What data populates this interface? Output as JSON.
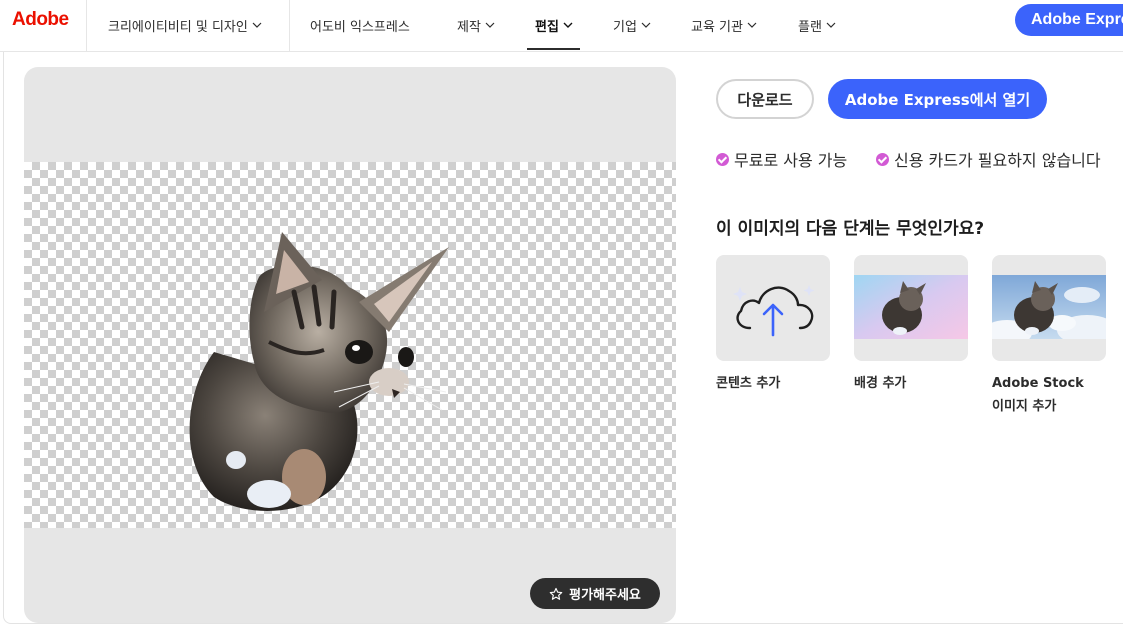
{
  "nav": {
    "logo": "Adobe",
    "items": [
      {
        "label": "크리에이티비티 및 디자인",
        "chevron": true
      },
      {
        "label": "어도비 익스프레스",
        "chevron": false
      },
      {
        "label": "제작",
        "chevron": true
      },
      {
        "label": "편집",
        "chevron": true,
        "active": true
      },
      {
        "label": "기업",
        "chevron": true
      },
      {
        "label": "교육 기관",
        "chevron": true
      },
      {
        "label": "플랜",
        "chevron": true
      }
    ],
    "cta": "Adobe Express"
  },
  "preview": {
    "rate_label": "평가해주세요",
    "rate_icon": "star-icon"
  },
  "actions": {
    "download": "다운로드",
    "open": "Adobe Express에서 열기"
  },
  "perks": [
    "무료로 사용 가능",
    "신용 카드가 필요하지 않습니다"
  ],
  "next_steps": {
    "title": "이 이미지의 다음 단계는 무엇인가요?",
    "items": [
      {
        "line1": "콘텐츠 추가",
        "line2": "",
        "icon": "cloud-upload-icon"
      },
      {
        "line1": "배경 추가",
        "line2": "",
        "icon": "kitten-gradient-thumbnail"
      },
      {
        "line1": "Adobe Stock",
        "line2": "이미지 추가",
        "icon": "kitten-sky-thumbnail"
      }
    ]
  },
  "colors": {
    "accent": "#3b63fb",
    "brand": "#eb1000",
    "check": "#d25ad4"
  }
}
